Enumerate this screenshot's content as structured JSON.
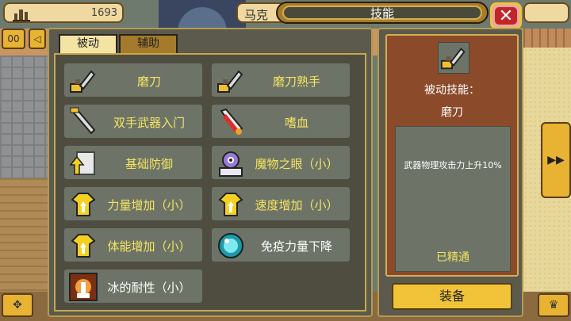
{
  "top_bar": {
    "money": "1693",
    "character_name": "马克",
    "title": "技能",
    "close_symbol": "✕"
  },
  "left_buttons": {
    "button1": "00",
    "button2": "◁"
  },
  "tabs": {
    "passive": "被动",
    "support": "辅助"
  },
  "skills": [
    {
      "label": "磨刀",
      "icon": "sword-whetstone-icon",
      "color": "#f4e462"
    },
    {
      "label": "磨刀熟手",
      "icon": "sword-whetstone-icon",
      "color": "#f4e462"
    },
    {
      "label": "双手武器入门",
      "icon": "two-handed-sword-icon",
      "color": "#f4e462"
    },
    {
      "label": "嗜血",
      "icon": "bloodthirst-icon",
      "color": "#f4e462"
    },
    {
      "label": "基础防御",
      "icon": "shield-up-icon",
      "color": "#f4e462"
    },
    {
      "label": "魔物之眼（小）",
      "icon": "monster-eye-icon",
      "color": "#f4e462"
    },
    {
      "label": "力量增加（小）",
      "icon": "shirt-up-icon",
      "color": "#f4e462"
    },
    {
      "label": "速度增加（小）",
      "icon": "shirt-up-icon",
      "color": "#f4e462"
    },
    {
      "label": "体能增加（小）",
      "icon": "shirt-up-icon",
      "color": "#f4e462"
    },
    {
      "label": "免疫力量下降",
      "icon": "orb-icon",
      "color": "#ffffff"
    },
    {
      "label": "冰的耐性（小）",
      "icon": "ice-resist-icon",
      "color": "#ffffff"
    }
  ],
  "detail": {
    "type_label": "被动技能：",
    "name": "磨刀",
    "description": "武器物理攻击力上升10%",
    "status": "已精通",
    "equip_label": "装备"
  },
  "side_buttons": {
    "right_arrow": "▶▶",
    "bottom_left": "✥",
    "bottom_right": "♛"
  }
}
